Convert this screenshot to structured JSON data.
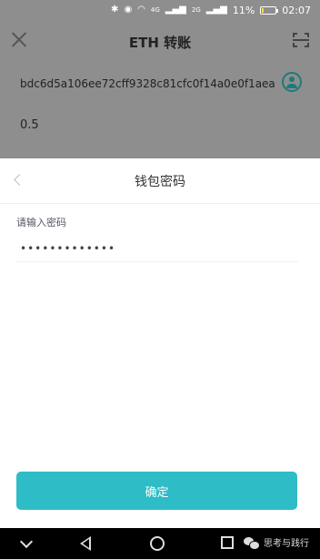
{
  "status_bar": {
    "battery_percent": "11%",
    "time": "02:07",
    "network_4g": "4G",
    "network_2g": "2G",
    "battery_fill": 0.11,
    "icons": [
      "bluetooth-icon",
      "eye-icon",
      "wifi-icon",
      "signal-icon",
      "battery-icon"
    ]
  },
  "background_screen": {
    "title": "ETH 转账",
    "address": "bdc6d5a106ee72cff9328c81cfc0f14a0e0f1aea",
    "amount": "0.5"
  },
  "sheet": {
    "title": "钱包密码",
    "password_label": "请输入密码",
    "password_value": "•••••••••••••",
    "confirm_label": "确定"
  },
  "nav_bar": {
    "watermark": "思考与践行"
  }
}
